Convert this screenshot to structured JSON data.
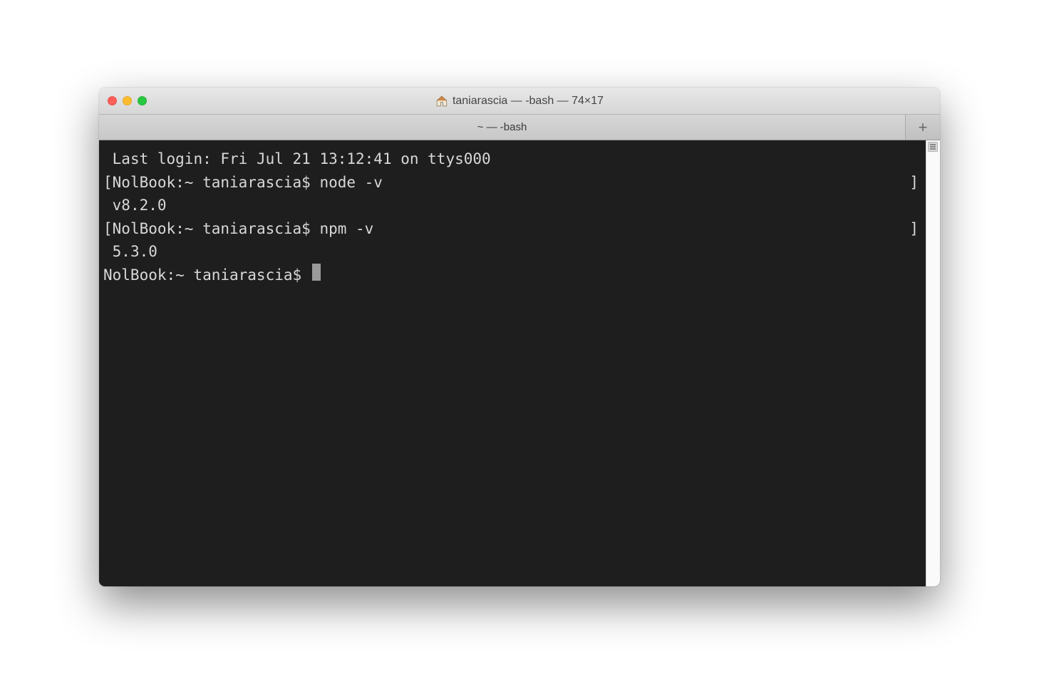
{
  "titlebar": {
    "title": "taniarascia — -bash — 74×17"
  },
  "tabbar": {
    "active_tab_label": "~ — -bash"
  },
  "terminal": {
    "lines": [
      {
        "prefix": " ",
        "text": "Last login: Fri Jul 21 13:12:41 on ttys000",
        "suffix": ""
      },
      {
        "prefix": "[",
        "text": "NolBook:~ taniarascia$ node -v",
        "suffix": "]"
      },
      {
        "prefix": " ",
        "text": "v8.2.0",
        "suffix": ""
      },
      {
        "prefix": "[",
        "text": "NolBook:~ taniarascia$ npm -v",
        "suffix": "]"
      },
      {
        "prefix": " ",
        "text": "5.3.0",
        "suffix": ""
      }
    ],
    "prompt": "NolBook:~ taniarascia$ "
  }
}
